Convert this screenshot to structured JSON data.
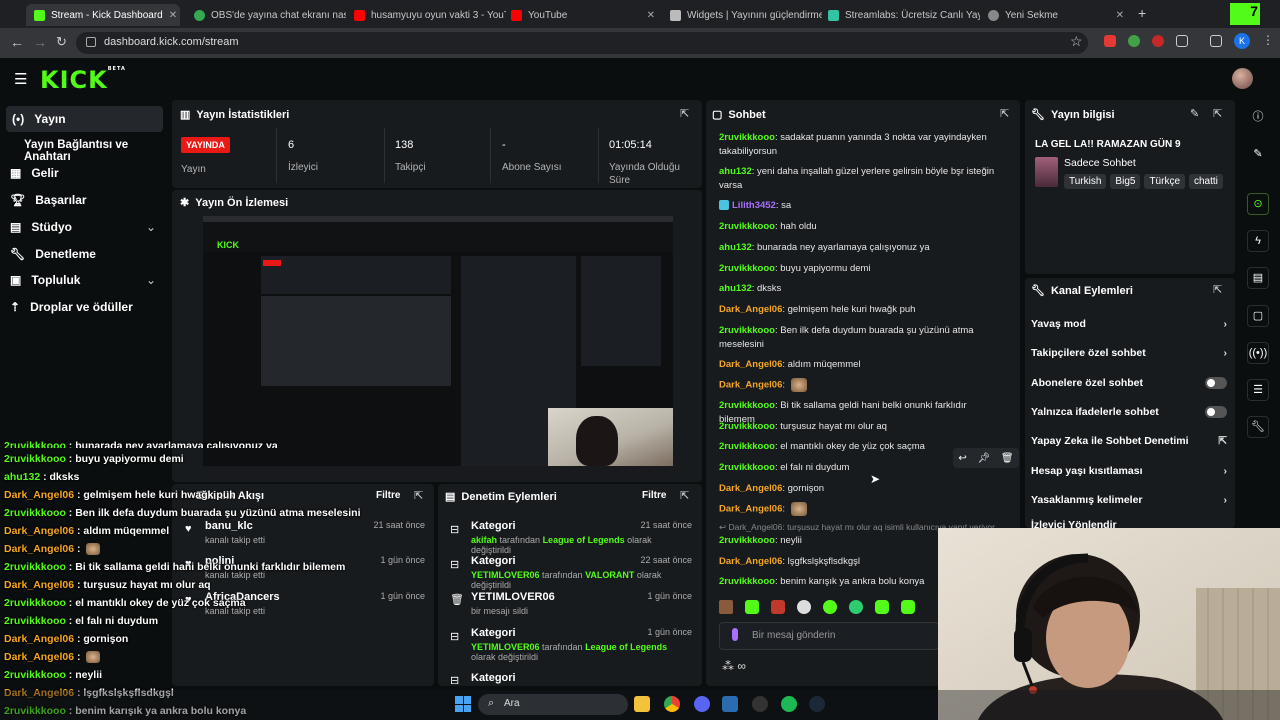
{
  "browser": {
    "tabs": [
      {
        "title": "Stream - Kick Dashboard"
      },
      {
        "title": "OBS'de yayına chat ekranı nasıl"
      },
      {
        "title": "husamyuyu oyun vakti 3 - YouT"
      },
      {
        "title": "YouTube"
      },
      {
        "title": "Widgets | Yayınını güçlendirme"
      },
      {
        "title": "Streamlabs: Ücretsiz Canlı Yayı"
      },
      {
        "title": "Yeni Sekme"
      }
    ],
    "url": "dashboard.kick.com/stream",
    "profile": "K",
    "new_tab": "+",
    "overlay_badge": "7"
  },
  "header": {
    "logo": "KICK",
    "beta": "BETA"
  },
  "sidebar": {
    "items": [
      {
        "label": "Yayın"
      },
      {
        "label": "Yayın Bağlantısı ve Anahtarı"
      },
      {
        "label": "Gelir"
      },
      {
        "label": "Başarılar"
      },
      {
        "label": "Stüdyo"
      },
      {
        "label": "Denetleme"
      },
      {
        "label": "Topluluk"
      },
      {
        "label": "Droplar ve ödüller"
      }
    ]
  },
  "stats": {
    "title": "Yayın İstatistikleri",
    "live": "YAYINDA",
    "items": [
      {
        "value": "",
        "label": "Yayın"
      },
      {
        "value": "6",
        "label": "İzleyici"
      },
      {
        "value": "138",
        "label": "Takipçi"
      },
      {
        "value": "-",
        "label": "Abone Sayısı"
      },
      {
        "value": "01:05:14",
        "label": "Yayında Olduğu Süre"
      }
    ]
  },
  "preview": {
    "title": "Yayın Ön İzlemesi"
  },
  "activity": {
    "title": "Etkinlik Akışı",
    "filter": "Filtre",
    "items": [
      {
        "user": "banu_klc",
        "action": "kanalı takip etti",
        "time": "21 saat önce"
      },
      {
        "user": "polini",
        "action": "kanalı takip etti",
        "time": "1 gün önce"
      },
      {
        "user": "AfricaDancers",
        "action": "kanalı takip etti",
        "time": "1 gün önce"
      }
    ]
  },
  "modlog": {
    "title": "Denetim Eylemleri",
    "filter": "Filtre",
    "items": [
      {
        "title": "Kategori",
        "who": "akifah",
        "mid": " tarafından ",
        "cat": "League of Legends",
        "tail": " olarak değiştirildi",
        "time": "21 saat önce"
      },
      {
        "title": "Kategori",
        "who": "YETIMLOVER06",
        "mid": " tarafından ",
        "cat": "VALORANT",
        "tail": " olarak değiştirildi",
        "time": "22 saat önce"
      },
      {
        "title": "YETIMLOVER06",
        "who": "",
        "mid": "bir mesajı sildi",
        "cat": "",
        "tail": "",
        "time": "1 gün önce"
      },
      {
        "title": "Kategori",
        "who": "YETIMLOVER06",
        "mid": " tarafından ",
        "cat": "League of Legends",
        "tail": " olarak değiştirildi",
        "time": "1 gün önce"
      },
      {
        "title": "Kategori",
        "who": "",
        "mid": "",
        "cat": "",
        "tail": "",
        "time": ""
      }
    ]
  },
  "chat": {
    "title": "Sohbet",
    "placeholder": "Bir mesaj gönderin",
    "reply": "Dark_Angel06: turşusuz hayat mı olur aq isimli kullanıcıya yanıt veriyor",
    "messages": [
      {
        "user": "2ruvikkkooo",
        "color": "#53fc18",
        "text": ": sadakat puanın yanında 3 nokta var yayindayken takabiliyorsun"
      },
      {
        "user": "ahu132",
        "color": "#53fc18",
        "text": ": yeni daha inşallah güzel yerlere gelirsin böyle bşr isteğin varsa"
      },
      {
        "user": "Lilith3452",
        "color": "#a970ff",
        "text": ": sa"
      },
      {
        "user": "2ruvikkkooo",
        "color": "#53fc18",
        "text": ": hah oldu"
      },
      {
        "user": "ahu132",
        "color": "#53fc18",
        "text": ": bunarada ney ayarlamaya çalışıyonuz ya"
      },
      {
        "user": "2ruvikkkooo",
        "color": "#53fc18",
        "text": ": buyu yapiyormu demi"
      },
      {
        "user": "ahu132",
        "color": "#53fc18",
        "text": ": dksks"
      },
      {
        "user": "Dark_Angel06",
        "color": "#f5a623",
        "text": ": gelmişem hele kuri hwağk puh"
      },
      {
        "user": "2ruvikkkooo",
        "color": "#53fc18",
        "text": ": Ben ilk defa duydum buarada şu yüzünü atma meselesini"
      },
      {
        "user": "Dark_Angel06",
        "color": "#f5a623",
        "text": ": aldım müqemmel"
      },
      {
        "user": "Dark_Angel06",
        "color": "#f5a623",
        "text": ":"
      },
      {
        "user": "2ruvikkkooo",
        "color": "#53fc18",
        "text": ": Bi tik sallama geldi hani belki onunki farklıdır bilemem"
      },
      {
        "user": "2ruvikkkooo",
        "color": "#53fc18",
        "text": ": turşusuz hayat mı olur aq"
      },
      {
        "user": "2ruvikkkooo",
        "color": "#53fc18",
        "text": ": el mantıklı okey de yüz çok saçma"
      },
      {
        "user": "2ruvikkkooo",
        "color": "#53fc18",
        "text": ": el falı ni duydum"
      },
      {
        "user": "Dark_Angel06",
        "color": "#f5a623",
        "text": ": gornişon"
      },
      {
        "user": "Dark_Angel06",
        "color": "#f5a623",
        "text": ":"
      },
      {
        "user": "2ruvikkkooo",
        "color": "#53fc18",
        "text": ": neylii"
      },
      {
        "user": "Dark_Angel06",
        "color": "#f5a623",
        "text": ": lşgfkslşkşflsdkgşl"
      },
      {
        "user": "2ruvikkkooo",
        "color": "#53fc18",
        "text": ": benim karışık ya ankra bolu konya"
      }
    ]
  },
  "streaminfo": {
    "title": "Yayın bilgisi",
    "stream_title": "LA GEL LA!! RAMAZAN GÜN 9",
    "category": "Sadece Sohbet",
    "tags": [
      "Turkish",
      "Big5",
      "Türkçe",
      "chatti"
    ]
  },
  "channel_actions": {
    "title": "Kanal Eylemleri",
    "items": [
      {
        "label": "Yavaş mod",
        "kind": "chevron"
      },
      {
        "label": "Takipçilere özel sohbet",
        "kind": "chevron"
      },
      {
        "label": "Abonelere özel sohbet",
        "kind": "toggle"
      },
      {
        "label": "Yalnızca ifadelerle sohbet",
        "kind": "toggle"
      },
      {
        "label": "Yapay Zeka ile Sohbet Denetimi",
        "kind": "link"
      },
      {
        "label": "Hesap yaşı kısıtlaması",
        "kind": "chevron"
      },
      {
        "label": "Yasaklanmış kelimeler",
        "kind": "chevron"
      },
      {
        "label": "İzleyici Yönlendir",
        "kind": "none"
      }
    ]
  },
  "overlay_chat": [
    {
      "user": "2ruvikkkooo",
      "color": "#53fc18",
      "text": " : bunarada ney ayarlamaya çalışıyonuz ya"
    },
    {
      "user": "2ruvikkkooo",
      "color": "#53fc18",
      "text": " : buyu yapiyormu demi"
    },
    {
      "user": "ahu132",
      "color": "#53fc18",
      "text": " : dksks"
    },
    {
      "user": "Dark_Angel06",
      "color": "#f5a623",
      "text": " : gelmişem hele kuri hwağk puh"
    },
    {
      "user": "2ruvikkkooo",
      "color": "#53fc18",
      "text": " : Ben ilk defa duydum buarada şu yüzünü atma meselesini"
    },
    {
      "user": "Dark_Angel06",
      "color": "#f5a623",
      "text": " : aldım müqemmel"
    },
    {
      "user": "Dark_Angel06",
      "color": "#f5a623",
      "text": " :"
    },
    {
      "user": "2ruvikkkooo",
      "color": "#53fc18",
      "text": " : Bi tik sallama geldi hani belki onunki farklıdır bilemem"
    },
    {
      "user": "Dark_Angel06",
      "color": "#f5a623",
      "text": " : turşusuz hayat mı olur aq"
    },
    {
      "user": "2ruvikkkooo",
      "color": "#53fc18",
      "text": " : el mantıklı okey de yüz çok saçma"
    },
    {
      "user": "2ruvikkkooo",
      "color": "#53fc18",
      "text": " : el falı ni duydum"
    },
    {
      "user": "Dark_Angel06",
      "color": "#f5a623",
      "text": " : gornişon"
    },
    {
      "user": "Dark_Angel06",
      "color": "#f5a623",
      "text": " :"
    },
    {
      "user": "2ruvikkkooo",
      "color": "#53fc18",
      "text": " : neylii"
    },
    {
      "user": "Dark_Angel06",
      "color": "#f5a623",
      "text": " : lşgfkslşkşflsdkgşl"
    },
    {
      "user": "2ruvikkkooo",
      "color": "#53fc18",
      "text": " : benim karışık ya ankra bolu konya"
    }
  ],
  "taskbar": {
    "search": "Ara"
  }
}
